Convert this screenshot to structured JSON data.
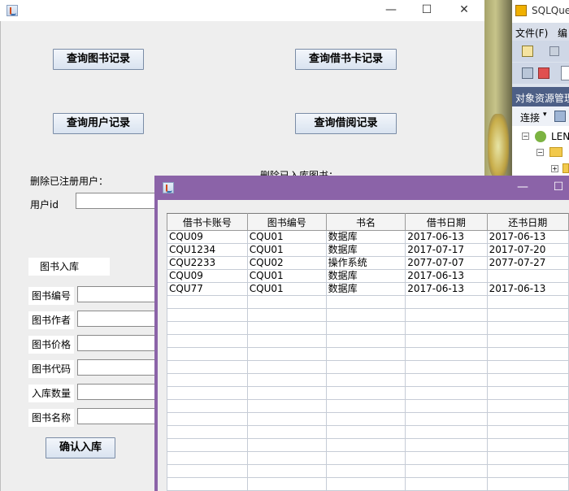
{
  "main": {
    "buttons": {
      "query_books": "查询图书记录",
      "query_cards": "查询借书卡记录",
      "query_users": "查询用户记录",
      "query_borrows": "查询借阅记录",
      "confirm_stock": "确认入库"
    },
    "labels": {
      "delete_user": "删除已注册用户：",
      "user_id": "用户id",
      "delete_book": "删除已入库图书：",
      "book_stock": "图书入库",
      "book_no": "图书编号",
      "book_author": "图书作者",
      "book_price": "图书价格",
      "book_code": "图书代码",
      "stock_qty": "入库数量",
      "book_name": "图书名称"
    },
    "window_controls": {
      "minimize": "—",
      "maximize": "☐",
      "close": "✕"
    }
  },
  "dialog": {
    "window_controls": {
      "minimize": "—",
      "maximize": "☐"
    },
    "columns": [
      "借书卡账号",
      "图书编号",
      "书名",
      "借书日期",
      "还书日期"
    ],
    "rows": [
      [
        "CQU09",
        "CQU01",
        "数据库",
        "2017-06-13",
        "2017-06-13"
      ],
      [
        "CQU1234",
        "CQU01",
        "数据库",
        "2017-07-17",
        "2017-07-20"
      ],
      [
        "CQU2233",
        "CQU02",
        "操作系统",
        "2077-07-07",
        "2077-07-27"
      ],
      [
        "CQU09",
        "CQU01",
        "数据库",
        "2017-06-13",
        ""
      ],
      [
        "CQU77",
        "CQU01",
        "数据库",
        "2017-06-13",
        "2017-06-13"
      ]
    ],
    "empty_rows": 15
  },
  "sql": {
    "title": "SQLQue",
    "menu_file": "文件(F)",
    "menu_edit": "编",
    "object_explorer": "对象资源管理",
    "connect": "连接",
    "tree_node": "LEN"
  },
  "colors": {
    "dialog_border": "#8b63a8",
    "button_border": "#7a8ca6"
  }
}
